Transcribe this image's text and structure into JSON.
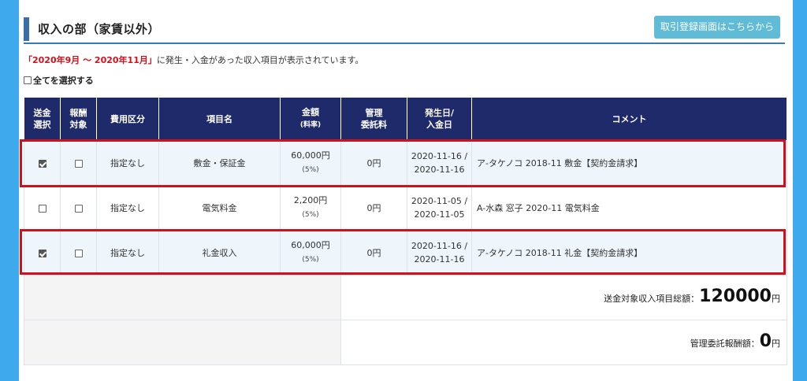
{
  "section": {
    "title": "収入の部（家賃以外）"
  },
  "toolbar": {
    "register_label": "取引登録画面はこちらから"
  },
  "notice": {
    "period": "「2020年9月 〜 2020年11月」",
    "text": "に発生・入金があった収入項目が表示されています。"
  },
  "select_all": {
    "label": "全てを選択する",
    "checked": false
  },
  "table": {
    "headers": {
      "send": "送金\n選択",
      "reward": "報酬\n対象",
      "category": "費用区分",
      "item": "項目名",
      "amount": "金額",
      "amount_sub": "(料率)",
      "fee": "管理\n委託料",
      "dates": "発生日/\n入金日",
      "comment": "コメント"
    },
    "rows": [
      {
        "send_checked": true,
        "reward_checked": false,
        "category": "指定なし",
        "item": "敷金・保証金",
        "amount": "60,000円",
        "rate": "(5%)",
        "fee": "0円",
        "occur": "2020-11-16 /",
        "paid": "2020-11-16",
        "comment": "ア-タケノコ 2018-11 敷金【契約金請求】",
        "highlighted": true
      },
      {
        "send_checked": false,
        "reward_checked": false,
        "category": "指定なし",
        "item": "電気料金",
        "amount": "2,200円",
        "rate": "(5%)",
        "fee": "0円",
        "occur": "2020-11-05 /",
        "paid": "2020-11-05",
        "comment": "A-水森 窓子 2020-11 電気料金",
        "highlighted": false
      },
      {
        "send_checked": true,
        "reward_checked": false,
        "category": "指定なし",
        "item": "礼金収入",
        "amount": "60,000円",
        "rate": "(5%)",
        "fee": "0円",
        "occur": "2020-11-16 /",
        "paid": "2020-11-16",
        "comment": "ア-タケノコ 2018-11 礼金【契約金請求】",
        "highlighted": true
      }
    ]
  },
  "totals": {
    "send_label": "送金対象収入項目総額：",
    "send_value": "120000",
    "send_unit": "円",
    "fee_label": "管理委託報酬額：",
    "fee_value": "0",
    "fee_unit": "円"
  },
  "colors": {
    "header_bg": "#1f2a6a",
    "highlight": "#d0101a",
    "button": "#5fbbd6",
    "period": "#d0101a"
  }
}
